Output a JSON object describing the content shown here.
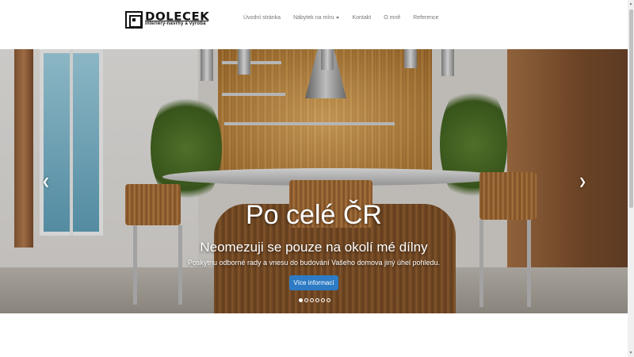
{
  "logo": {
    "name": "DOLECEK",
    "tagline": "interiéry-návrhy a výroba"
  },
  "nav": {
    "items": [
      {
        "label": "Úvodní stránka"
      },
      {
        "label": "Nábytek na míru",
        "dropdown": true
      },
      {
        "label": "Kontakt"
      },
      {
        "label": "O mně"
      },
      {
        "label": "Reference"
      }
    ]
  },
  "hero": {
    "title": "Po celé ČR",
    "subtitle": "Neomezuji se pouze na okolí mé dílny",
    "description": "Poskytnu odborné rady a vnesu do budování Vašeho domova jiný úhel pohledu.",
    "cta_label": "Více informací",
    "slides_total": 6,
    "active_slide": 1,
    "prev_icon": "chevron-left-icon",
    "next_icon": "chevron-right-icon"
  },
  "colors": {
    "accent": "#2c7bc4",
    "nav_text": "#777777"
  }
}
